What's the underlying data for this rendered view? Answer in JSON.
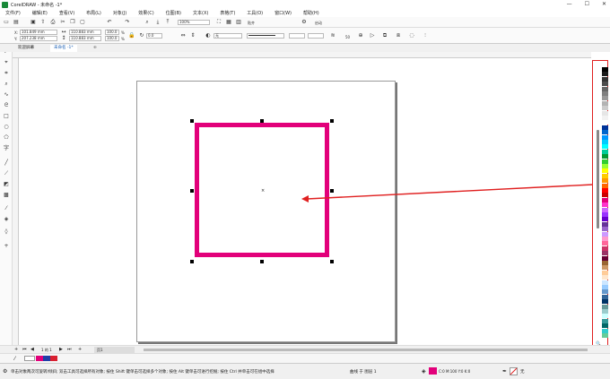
{
  "titlebar": {
    "title": "CorelDRAW - 未命名 -1*",
    "minimize": "—",
    "maximize": "☐",
    "close": "✕"
  },
  "menu": [
    "文件(F)",
    "编辑(E)",
    "查看(V)",
    "布局(L)",
    "对象(J)",
    "效果(C)",
    "位图(B)",
    "文本(X)",
    "表格(T)",
    "工具(O)",
    "窗口(W)",
    "帮助(H)"
  ],
  "toolbar1": {
    "zoom": "100%",
    "snap": "贴齐",
    "launch": "启动"
  },
  "property_bar": {
    "x": "101.849 mm",
    "y": "207.238 mm",
    "width": "110.883 mm",
    "height": "110.883 mm",
    "scale_w": "100.0",
    "scale_h": "100.0",
    "scale_unit": "%",
    "angle": "0.0",
    "fill": "无",
    "outline_size": "50"
  },
  "tabs": [
    {
      "label": "欢迎屏幕"
    },
    {
      "label": "未命名 -1*"
    }
  ],
  "page_nav": {
    "counter": "1 的 1",
    "page_label": "页1"
  },
  "status": {
    "message": "单击对象两次可旋转/倾斜; 双击工具可选择所有对象; 按住 Shift 键单击可选择多个对象; 按住 Alt 键单击可进行挖掘; 按住 Ctrl 并单击可在组中选择",
    "object_info": "曲线 于 图层 1",
    "fill_values": "C:0 M:100 Y:0 K:0",
    "outline": "无"
  },
  "colors": {
    "rect_outline": "#e2007a",
    "palette": [
      "#000000",
      "#1a1a1a",
      "#333333",
      "#4d4d4d",
      "#666666",
      "#808080",
      "#999999",
      "#b3b3b3",
      "#cccccc",
      "#e6e6e6",
      "#f2f2f2",
      "#ffffff",
      "#003399",
      "#0066cc",
      "#0099ff",
      "#00ccff",
      "#00ffff",
      "#00cc99",
      "#009933",
      "#33cc33",
      "#99ff33",
      "#ffff00",
      "#ffcc00",
      "#ff9900",
      "#ff6600",
      "#ff0000",
      "#cc0000",
      "#e2007a",
      "#ff33cc",
      "#cc66ff",
      "#9933ff",
      "#6600cc",
      "#663399",
      "#9966cc",
      "#cc99ff",
      "#ff99cc",
      "#ff6699",
      "#cc3366",
      "#993366",
      "#660033",
      "#996633",
      "#cc9966",
      "#ffcc99",
      "#ffe6cc",
      "#cce6ff",
      "#99ccff",
      "#6699cc",
      "#336699",
      "#003366",
      "#669999",
      "#99cccc",
      "#ccffff",
      "#339999",
      "#006666",
      "#33cccc",
      "#66cc99"
    ]
  }
}
